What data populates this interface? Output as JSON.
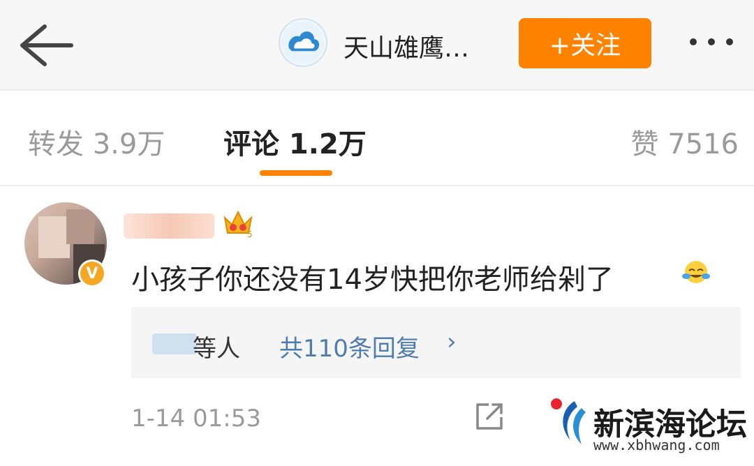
{
  "header": {
    "account_name": "天山雄鹰…",
    "follow_label": "+关注"
  },
  "tabs": {
    "repost": "转发 3.9万",
    "comment": "评论 1.2万",
    "like": "赞 7516",
    "active": "comment"
  },
  "comment": {
    "text": "小孩子你还没有14岁快把你老师给剁了",
    "verified_badge": "V",
    "reply_people": "等人",
    "reply_count": "共110条回复",
    "reply_chevron": "›",
    "timestamp": "1-14 01:53"
  },
  "watermark": {
    "title": "新滨海论坛",
    "url": "www.xbhwang.com"
  },
  "colors": {
    "accent": "#ff8200",
    "link": "#4f7cae",
    "muted": "#9a9a9a"
  }
}
